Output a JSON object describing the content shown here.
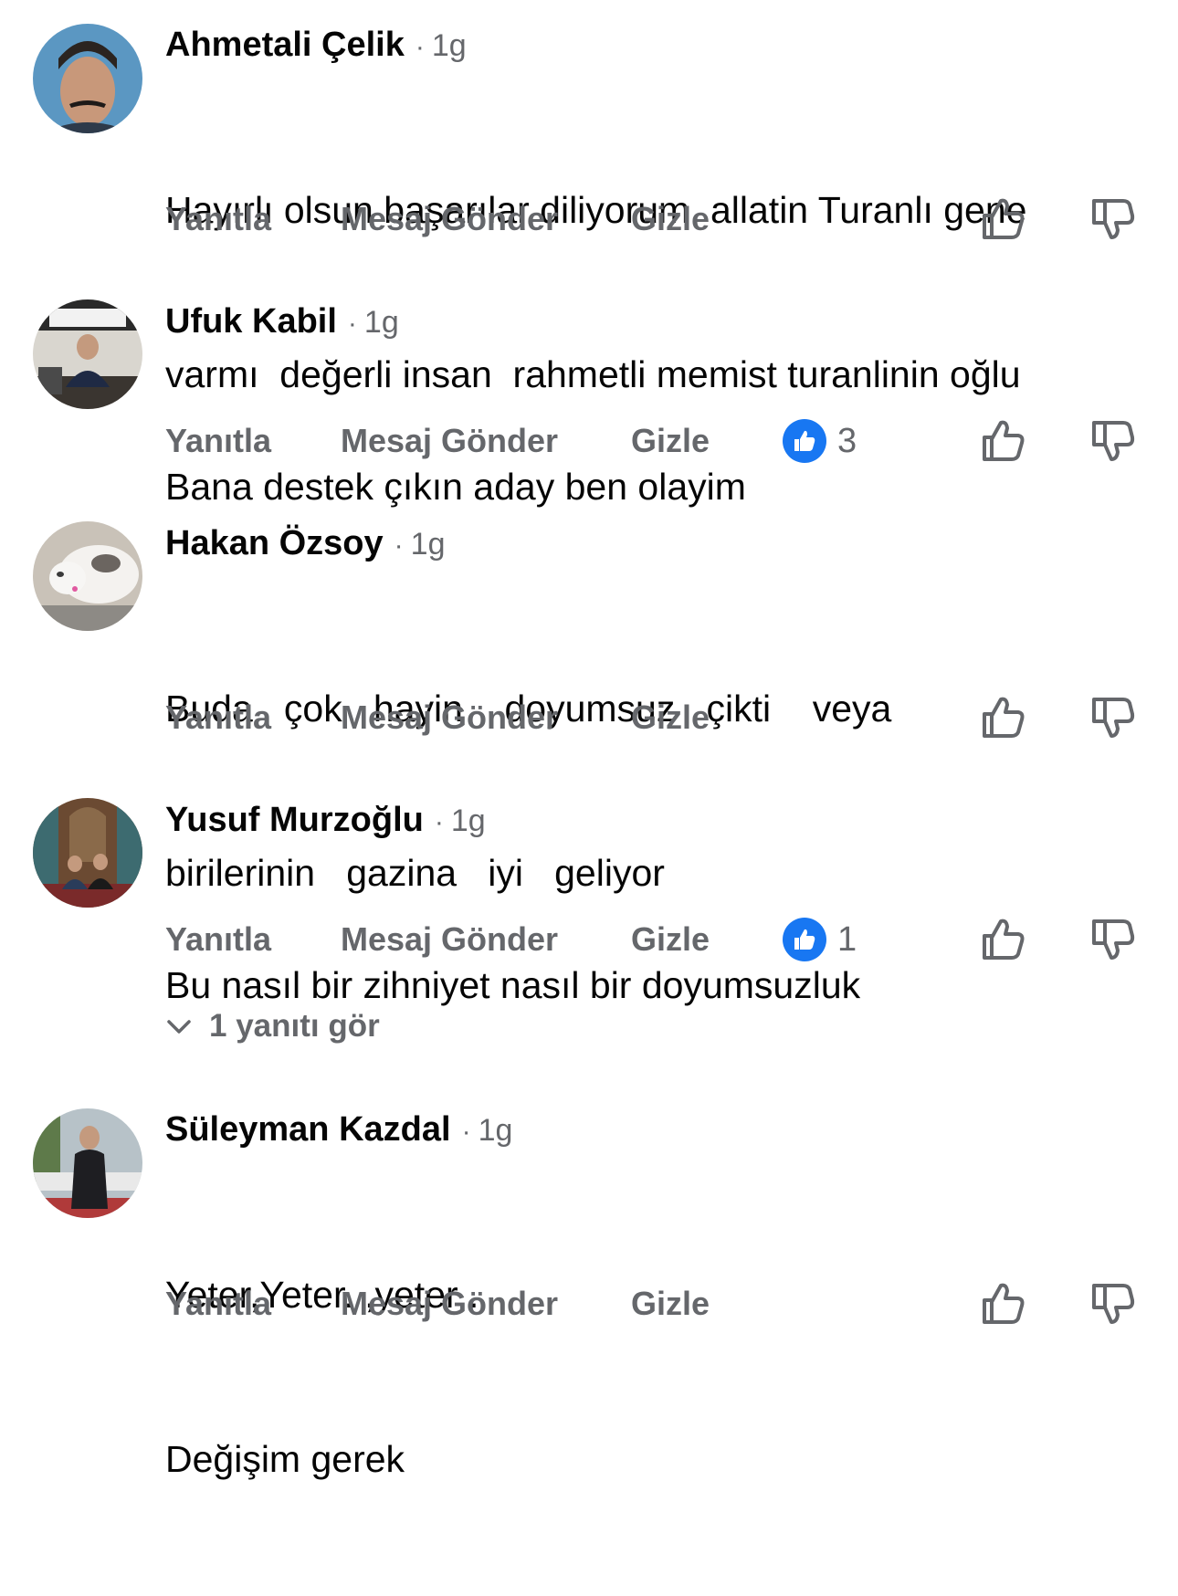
{
  "actions": {
    "reply_label": "Yanıtla",
    "message_label": "Mesaj Gönder",
    "hide_label": "Gizle"
  },
  "comments": [
    {
      "author": "Ahmetali Çelik",
      "time": "1g",
      "lines": [
        "Hayırlı olsun başarılar diliyorum  allatin Turanlı gene",
        "varmı  değerli insan  rahmetli memist turanlinin oğlu"
      ]
    },
    {
      "author": "Ufuk Kabil",
      "time": "1g",
      "lines": [
        "Bana destek çıkın aday ben olayim"
      ],
      "like_count": "3"
    },
    {
      "author": "Hakan Özsoy",
      "time": "1g",
      "lines": [
        "Buda   çok   hayin    doyumsuz   çikti    veya",
        "birilerinin   gazina   iyi   geliyor"
      ]
    },
    {
      "author": "Yusuf Murzoğlu",
      "time": "1g",
      "lines": [
        "Bu nasıl bir zihniyet nasıl bir doyumsuzluk"
      ],
      "like_count": "1"
    },
    {
      "author": "Süleyman Kazdal",
      "time": "1g",
      "lines": [
        "Yeter,Yeter. ,yeter .",
        "Değişim gerek"
      ]
    }
  ],
  "see_replies": {
    "label": "1 yanıtı gör"
  },
  "colors": {
    "text_primary": "#050505",
    "text_secondary": "#65676b",
    "like_blue": "#1877f2"
  }
}
